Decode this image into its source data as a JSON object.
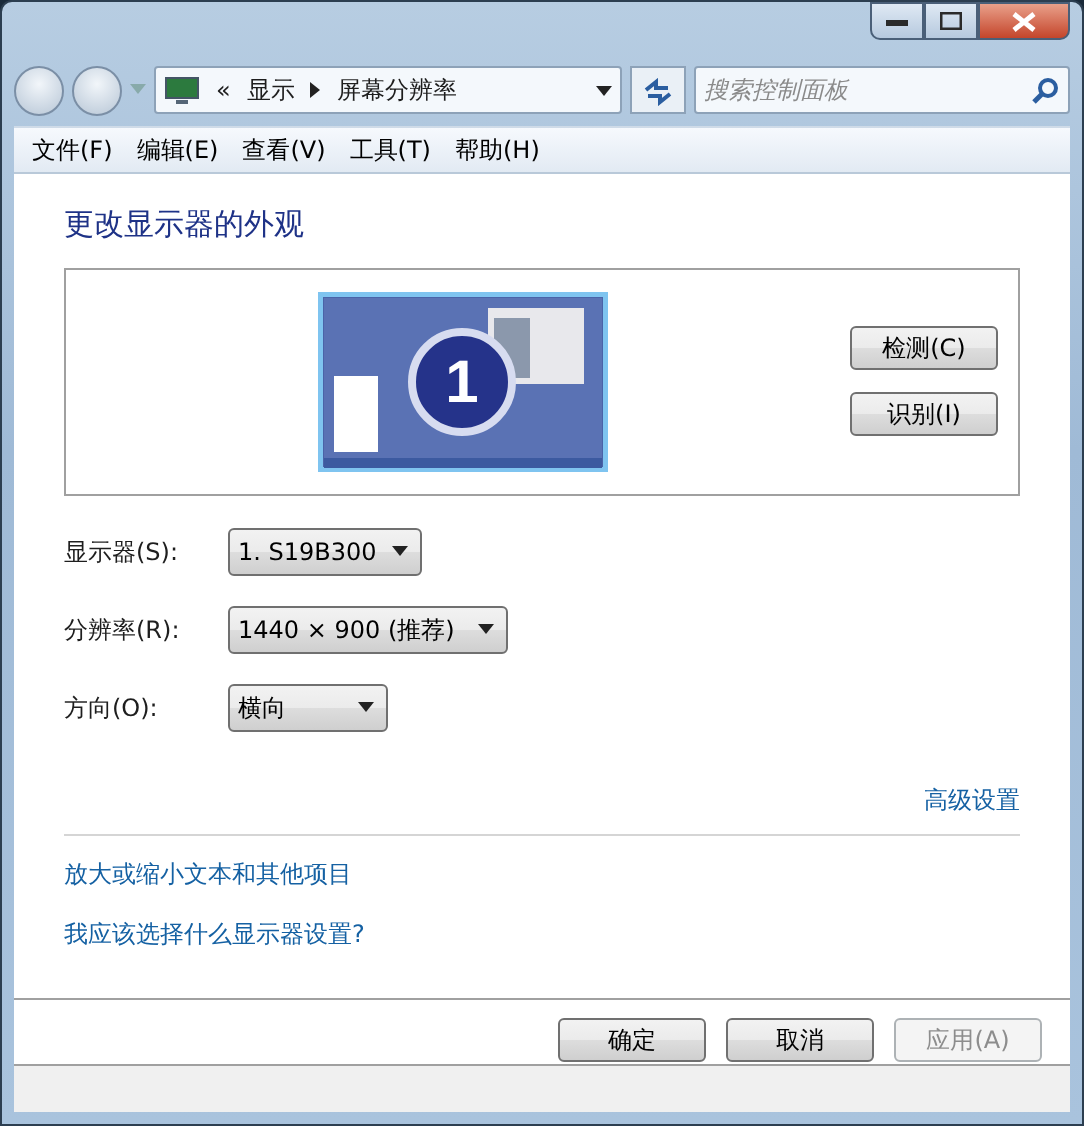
{
  "address_bar": {
    "overflow": "«",
    "crumbs": [
      "显示",
      "屏幕分辨率"
    ]
  },
  "search": {
    "placeholder": "搜索控制面板"
  },
  "menu": [
    "文件(F)",
    "编辑(E)",
    "查看(V)",
    "工具(T)",
    "帮助(H)"
  ],
  "heading": "更改显示器的外观",
  "monitor_preview": {
    "number": "1",
    "selected": true
  },
  "preview_buttons": [
    "检测(C)",
    "识别(I)"
  ],
  "settings": [
    {
      "label": "显示器(S):",
      "value": "1. S19B300"
    },
    {
      "label": "分辨率(R):",
      "value": "1440 × 900 (推荐)"
    },
    {
      "label": "方向(O):",
      "value": "横向"
    }
  ],
  "advanced_link": "高级设置",
  "links": [
    "放大或缩小文本和其他项目",
    "我应该选择什么显示器设置?"
  ],
  "footer_buttons": [
    {
      "label": "确定",
      "disabled": false
    },
    {
      "label": "取消",
      "disabled": false
    },
    {
      "label": "应用(A)",
      "disabled": true
    }
  ]
}
